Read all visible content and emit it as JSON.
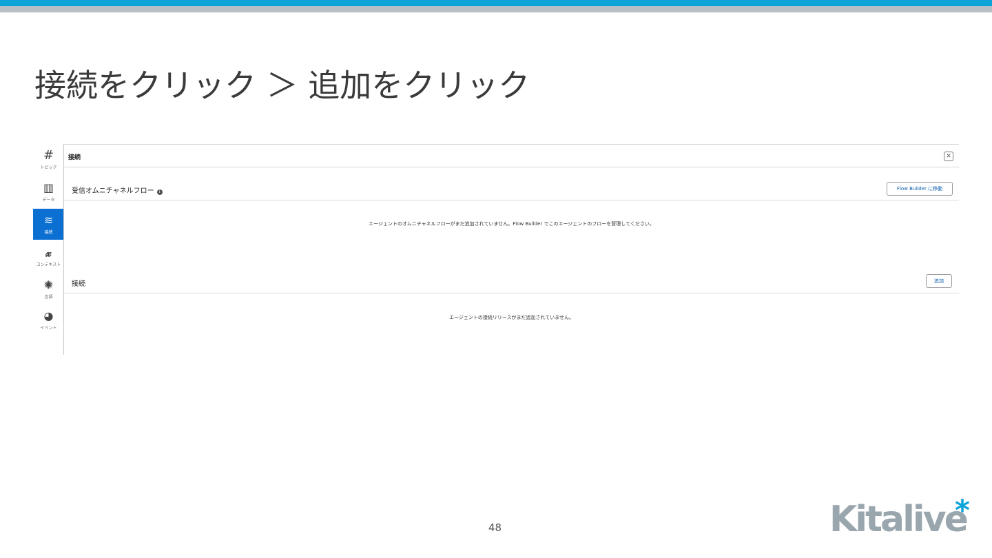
{
  "slide": {
    "title": "接続をクリック ＞ 追加をクリック",
    "page_number": "48"
  },
  "logo": {
    "text": "Kitalive",
    "mark": "*"
  },
  "colors": {
    "accent_cyan": "#0aa4d8",
    "bar_gray": "#b8bfc4",
    "active_rail": "#0b70d1"
  },
  "rail": {
    "items": [
      {
        "label": "トピック",
        "icon": "hash-icon",
        "glyph": "#",
        "active": false
      },
      {
        "label": "データ",
        "icon": "library-icon",
        "glyph": "▥",
        "active": false
      },
      {
        "label": "接続",
        "icon": "layers-icon",
        "glyph": "≋",
        "active": true
      },
      {
        "label": "コンテキスト",
        "icon": "variable-icon",
        "glyph": "𝔁",
        "active": false
      },
      {
        "label": "言語",
        "icon": "palette-icon",
        "glyph": "✺",
        "active": false
      },
      {
        "label": "イベント",
        "icon": "event-icon",
        "glyph": "◕",
        "active": false
      }
    ]
  },
  "panel": {
    "title": "接続",
    "close_label": "✕"
  },
  "omni_section": {
    "title": "受信オムニチャネルフロー",
    "info": "i",
    "button_label": "Flow Builder に移動",
    "empty_message": "エージェントのオムニチャネルフローがまだ追加されていません。Flow Builder でこのエージェントのフローを管理してください。"
  },
  "connections_section": {
    "title": "接続",
    "button_label": "追加",
    "empty_message": "エージェントの接続リリースがまだ追加されていません。"
  }
}
